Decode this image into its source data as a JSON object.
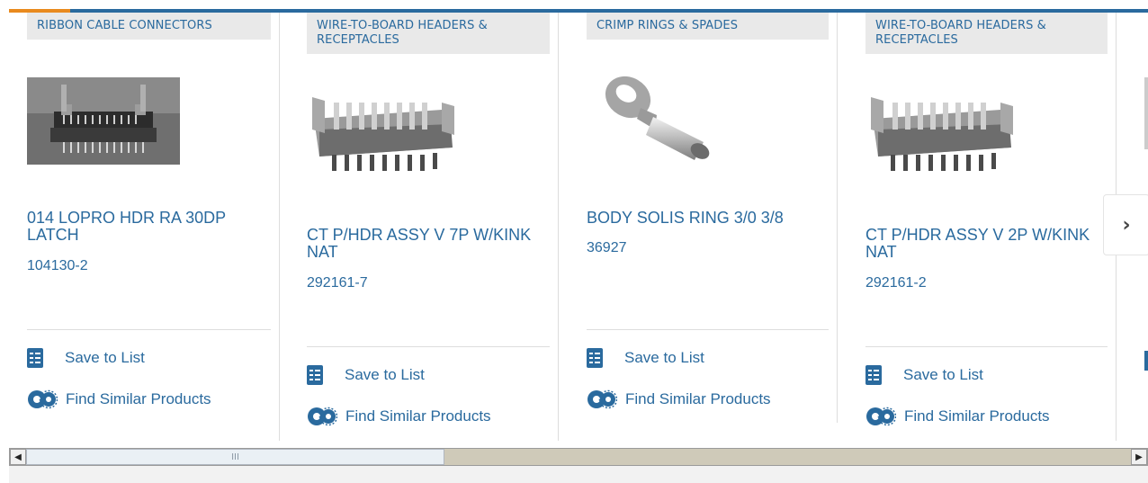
{
  "cards": [
    {
      "category": "RIBBON CABLE CONNECTORS",
      "name": "014 LOPRO HDR RA 30DP LATCH",
      "part_number": "104130-2",
      "save_label": "Save to List",
      "similar_label": "Find Similar Products",
      "image_icon": "ribbon-connector-image"
    },
    {
      "category": "WIRE-TO-BOARD HEADERS & RECEPTACLES",
      "name": "CT P/HDR ASSY V 7P W/KINK NAT",
      "part_number": "292161-7",
      "save_label": "Save to List",
      "similar_label": "Find Similar Products",
      "image_icon": "header-image"
    },
    {
      "category": "CRIMP RINGS & SPADES",
      "name": "BODY SOLIS RING 3/0 3/8",
      "part_number": "36927",
      "save_label": "Save to List",
      "similar_label": "Find Similar Products",
      "image_icon": "ring-terminal-image"
    },
    {
      "category": "WIRE-TO-BOARD HEADERS & RECEPTACLES",
      "name": "CT P/HDR ASSY V 2P W/KINK NAT",
      "part_number": "292161-2",
      "save_label": "Save to List",
      "similar_label": "Find Similar Products",
      "image_icon": "header-image"
    }
  ],
  "next_button": "›",
  "scrollbar": {
    "grip": "III"
  },
  "colors": {
    "accent": "#2a6a9e",
    "highlight": "#e98a1e"
  }
}
